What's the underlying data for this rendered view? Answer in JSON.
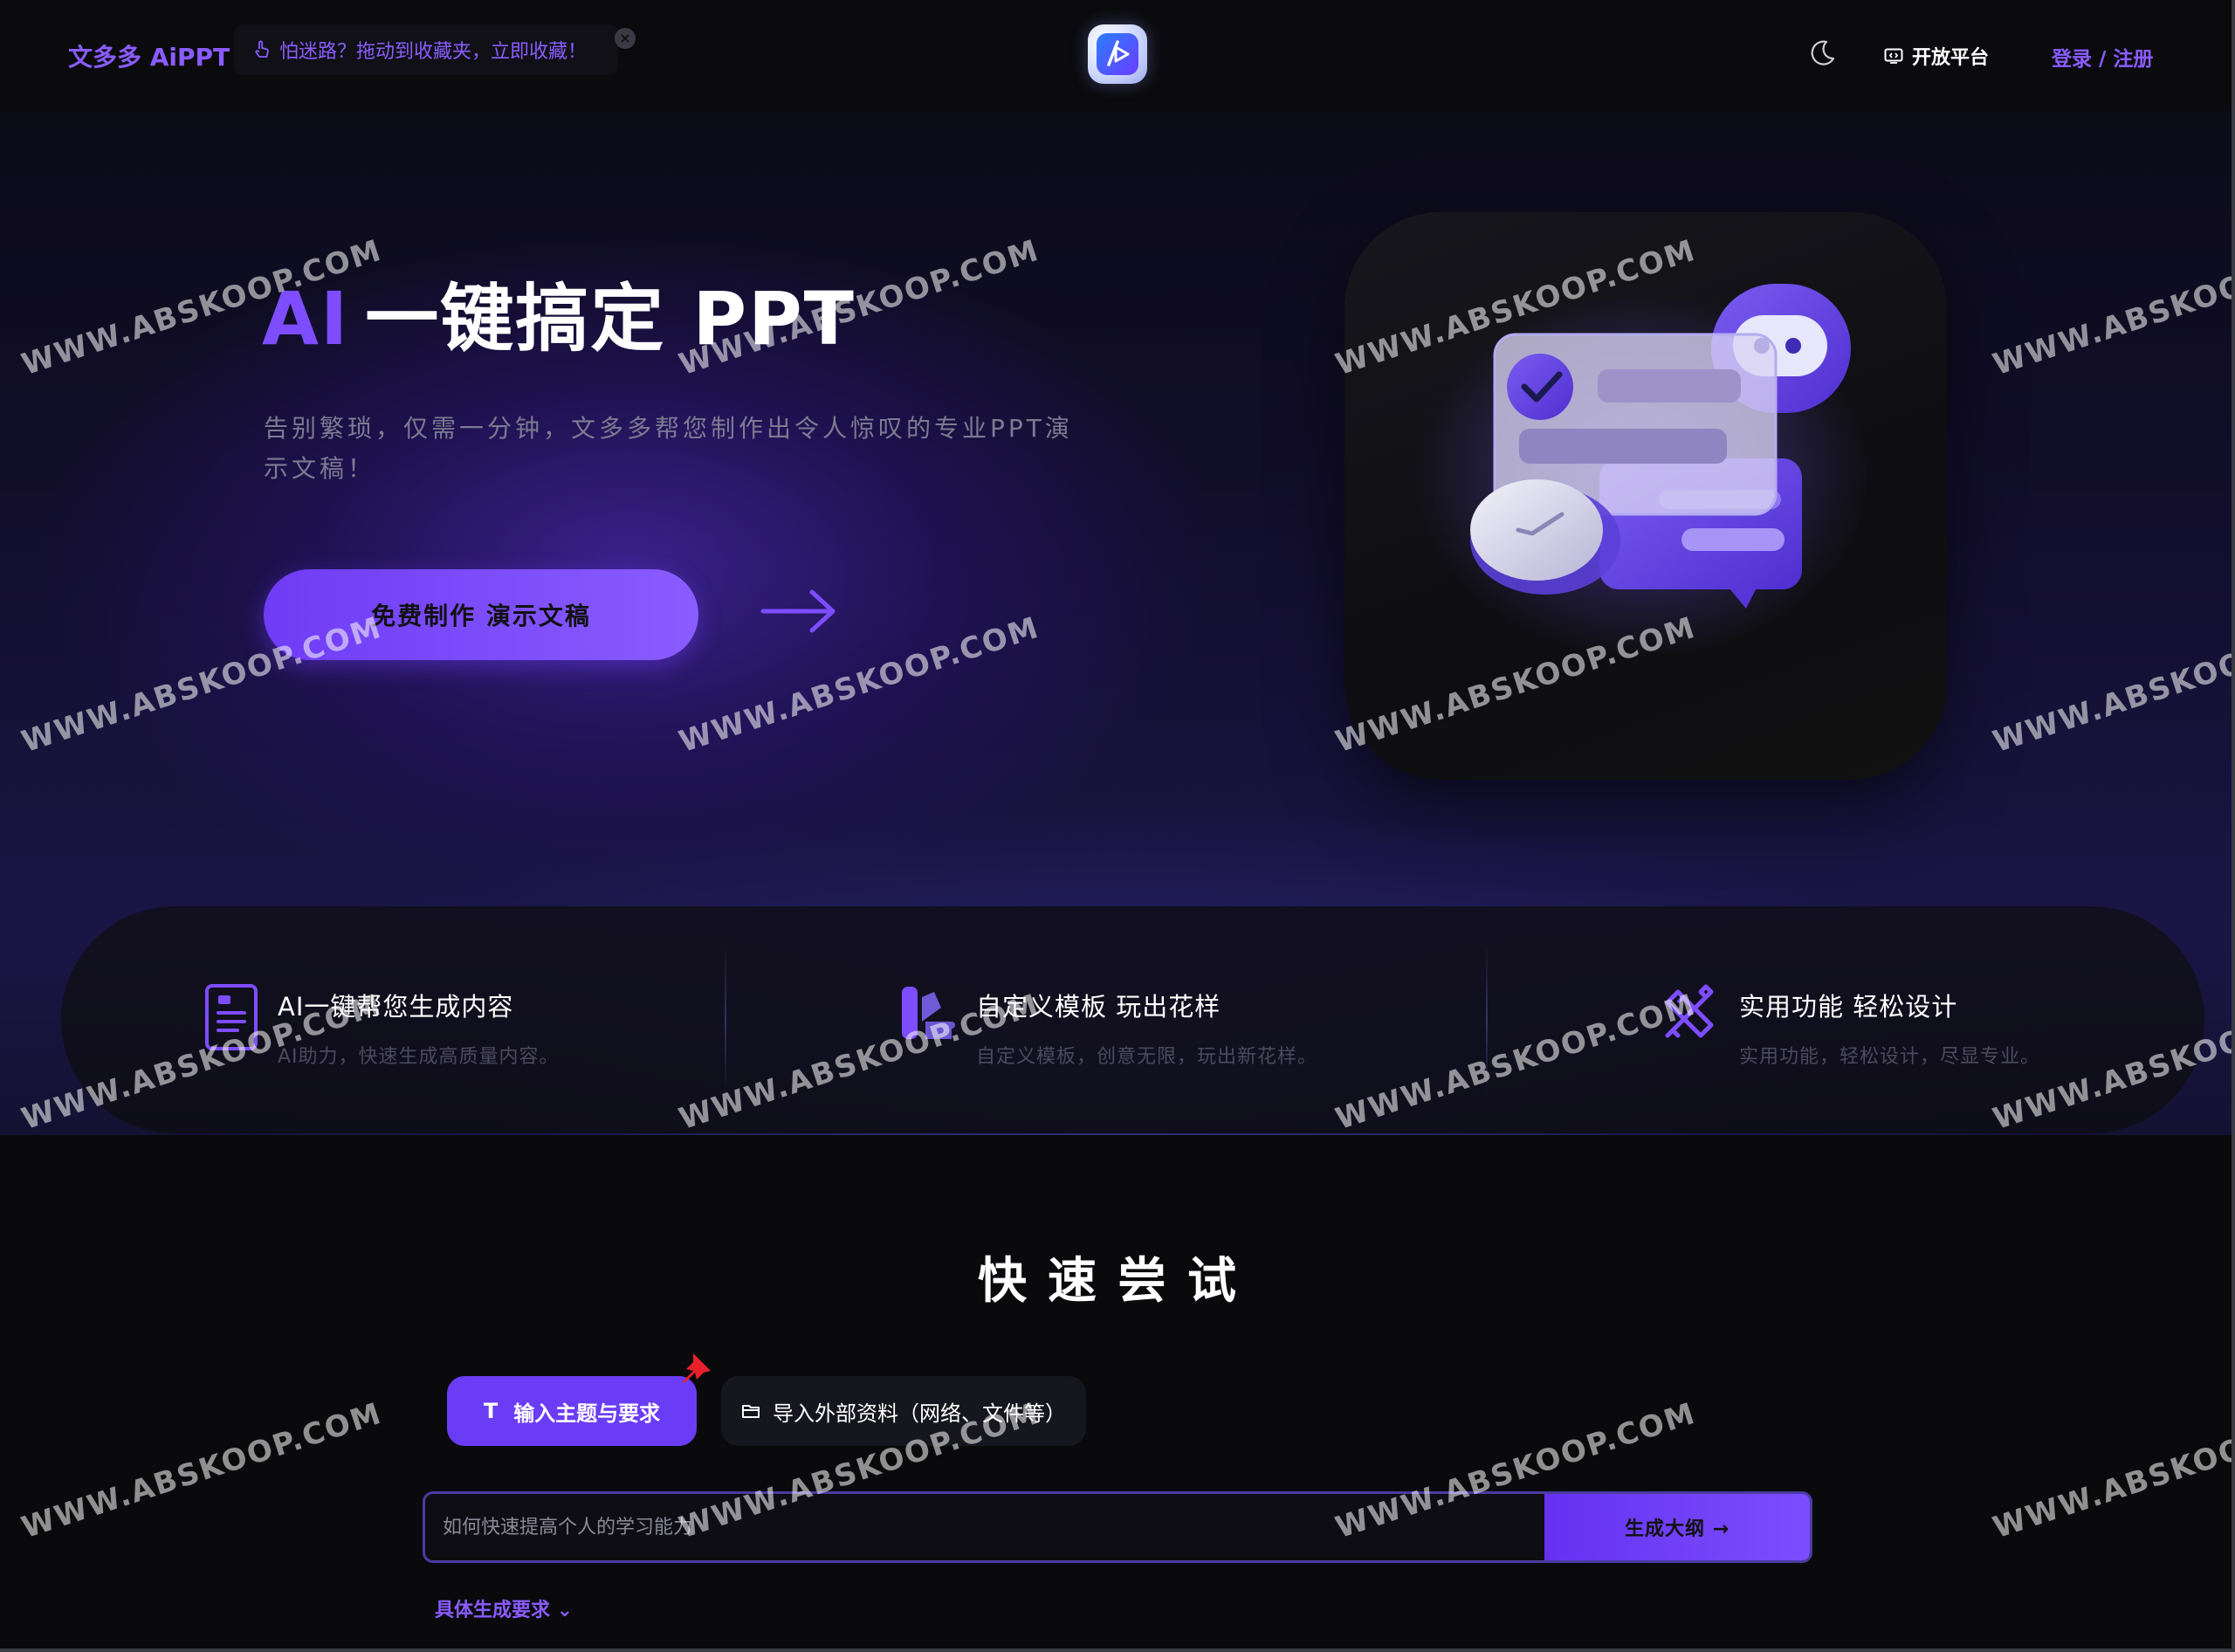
{
  "header": {
    "brand": "文多多 AiPPT",
    "tip": "怕迷路？拖动到收藏夹，立即收藏！",
    "tip_close": "×",
    "open_platform": "开放平台",
    "login": "登录 / 注册"
  },
  "hero": {
    "title_ai": "AI",
    "title_rest": "一键搞定 PPT",
    "subtitle": "告别繁琐，仅需一分钟，文多多帮您制作出令人惊叹的专业PPT演示文稿！",
    "cta": "免费制作 演示文稿"
  },
  "features": [
    {
      "title": "AI一键帮您生成内容",
      "desc": "AI助力，快速生成高质量内容。",
      "icon": "document-icon"
    },
    {
      "title": "自定义模板 玩出花样",
      "desc": "自定义模板，创意无限，玩出新花样。",
      "icon": "template-icon"
    },
    {
      "title": "实用功能 轻松设计",
      "desc": "实用功能，轻松设计，尽显专业。",
      "icon": "design-tools-icon"
    }
  ],
  "quick_try": {
    "title": "快速尝试",
    "tab_topic": "输入主题与要求",
    "tab_import": "导入外部资料（网络、文件等）",
    "input_placeholder": "如何快速提高个人的学习能力",
    "generate": "生成大纲 →",
    "spec": "具体生成要求 ⌄"
  },
  "watermark": "WWW.ABSKOOP.COM",
  "colors": {
    "accent": "#7d4dff",
    "background": "#0a0a0c",
    "cta": "#7a4bff"
  }
}
